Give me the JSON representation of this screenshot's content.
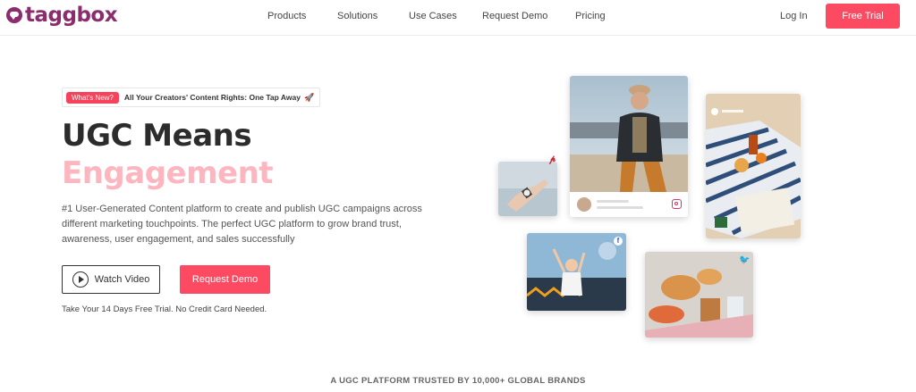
{
  "brand": {
    "name": "taggbox",
    "color": "#8b2c6d"
  },
  "nav": {
    "items": [
      {
        "label": "Products"
      },
      {
        "label": "Solutions"
      },
      {
        "label": "Use Cases"
      },
      {
        "label": "Request Demo"
      },
      {
        "label": "Pricing"
      }
    ],
    "login": "Log In",
    "free_trial": "Free Trial"
  },
  "hero": {
    "badge": {
      "pill": "What's New?",
      "text": "All Your Creators' Content Rights: One Tap Away"
    },
    "title_line1": "UGC Means",
    "title_line2": "Engagement",
    "description": "#1 User-Generated Content platform to create and publish UGC campaigns across different marketing touchpoints. The perfect UGC platform to grow brand trust, awareness, user engagement, and sales successfully",
    "watch_video": "Watch Video",
    "request_demo": "Request Demo",
    "trial_note": "Take Your 14 Days Free Trial. No Credit Card Needed."
  },
  "trusted": "A UGC PLATFORM TRUSTED BY 10,000+ GLOBAL BRANDS",
  "colors": {
    "accent": "#fb4a62",
    "pink_text": "#fdb6bf"
  },
  "icons": [
    "play-icon",
    "pinterest-icon",
    "instagram-icon",
    "facebook-icon",
    "twitter-icon",
    "rocket-icon"
  ]
}
